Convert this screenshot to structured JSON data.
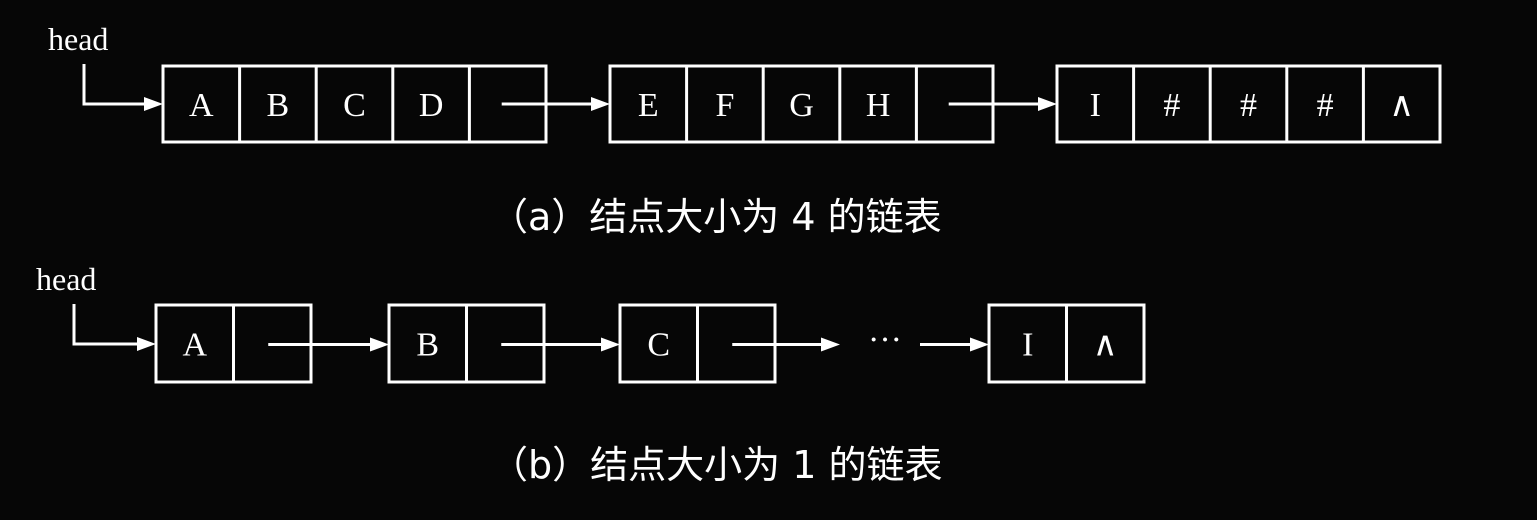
{
  "diagram_a": {
    "head_label": "head",
    "nodes": [
      [
        "A",
        "B",
        "C",
        "D",
        ""
      ],
      [
        "E",
        "F",
        "G",
        "H",
        ""
      ],
      [
        "I",
        "#",
        "#",
        "#",
        "∧"
      ]
    ],
    "caption": "（a）结点大小为 4 的链表"
  },
  "diagram_b": {
    "head_label": "head",
    "nodes": [
      [
        "A",
        ""
      ],
      [
        "B",
        ""
      ],
      [
        "C",
        ""
      ],
      [
        "I",
        "∧"
      ]
    ],
    "ellipsis": "···",
    "caption": "（b）结点大小为 1 的链表"
  }
}
